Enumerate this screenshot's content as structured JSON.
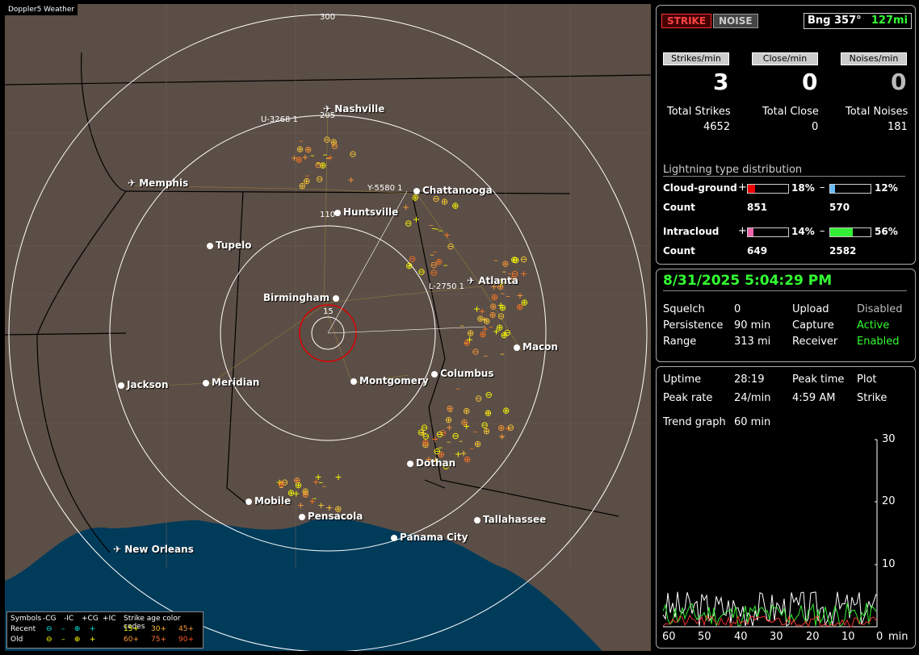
{
  "map": {
    "title": "Doppler5 Weather",
    "rings": [
      "300",
      "205",
      "110",
      "15"
    ],
    "callouts": [
      "U-3268 1",
      "Y-5580 1",
      "L-2750 1"
    ],
    "cities": [
      "Nashville",
      "Memphis",
      "Chattanooga",
      "Huntsville",
      "Tupelo",
      "Atlanta",
      "Birmingham",
      "Macon",
      "Jackson",
      "Meridian",
      "Montgomery",
      "Columbus",
      "Dothan",
      "Mobile",
      "Pensacola",
      "Tallahassee",
      "Panama City",
      "New Orleans"
    ],
    "legend": {
      "symbols_label": "Symbols",
      "cols": [
        "-CG",
        "-IC",
        "+CG",
        "+IC"
      ],
      "age_label": "Strike age color codes",
      "recent": "Recent",
      "old": "Old",
      "ages_recent": [
        "15+",
        "30+",
        "45+"
      ],
      "ages_old": [
        "60+",
        "75+",
        "90+"
      ]
    }
  },
  "status": {
    "strike": "STRIKE",
    "noise": "NOISE",
    "bearing": "Bng 357°",
    "distance": "127mi",
    "strikes_min_label": "Strikes/min",
    "close_min_label": "Close/min",
    "noises_min_label": "Noises/min",
    "strikes_min": "3",
    "close_min": "0",
    "noises_min": "0",
    "total_strikes_label": "Total Strikes",
    "total_close_label": "Total Close",
    "total_noises_label": "Total Noises",
    "total_strikes": "4652",
    "total_close": "0",
    "total_noises": "181",
    "dist_title": "Lightning type distribution",
    "cg_label": "Cloud-ground",
    "ic_label": "Intracloud",
    "count_label": "Count",
    "cg_pos_pct": "18%",
    "cg_neg_pct": "12%",
    "ic_pos_pct": "14%",
    "ic_neg_pct": "56%",
    "cg_pos_frac": 0.18,
    "cg_neg_frac": 0.12,
    "ic_pos_frac": 0.14,
    "ic_neg_frac": 0.56,
    "cg_pos_count": "851",
    "cg_neg_count": "570",
    "ic_pos_count": "649",
    "ic_neg_count": "2582",
    "plus": "+",
    "minus": "–"
  },
  "settings": {
    "datetime": "8/31/2025 5:04:29 PM",
    "squelch_label": "Squelch",
    "squelch": "0",
    "persistence_label": "Persistence",
    "persistence": "90 min",
    "range_label": "Range",
    "range": "313 mi",
    "upload_label": "Upload",
    "upload": "Disabled",
    "capture_label": "Capture",
    "capture": "Active",
    "receiver_label": "Receiver",
    "receiver": "Enabled"
  },
  "trend": {
    "uptime_label": "Uptime",
    "uptime": "28:19",
    "peak_time_label": "Peak time",
    "plot_label": "Plot",
    "peak_rate_label": "Peak rate",
    "peak_rate": "24/min",
    "peak_time": "4:59 AM",
    "plot": "Strike",
    "trend_label": "Trend graph",
    "trend": "60 min",
    "y_ticks": [
      "30",
      "20",
      "10"
    ],
    "x_ticks": [
      "60",
      "50",
      "40",
      "30",
      "20",
      "10",
      "0"
    ],
    "x_unit": "min"
  },
  "colors": {
    "strike_recent": "#ffff00",
    "strike_mid": "#ff9900",
    "strike_old": "#ff6600",
    "panel_green": "#33ff33"
  }
}
